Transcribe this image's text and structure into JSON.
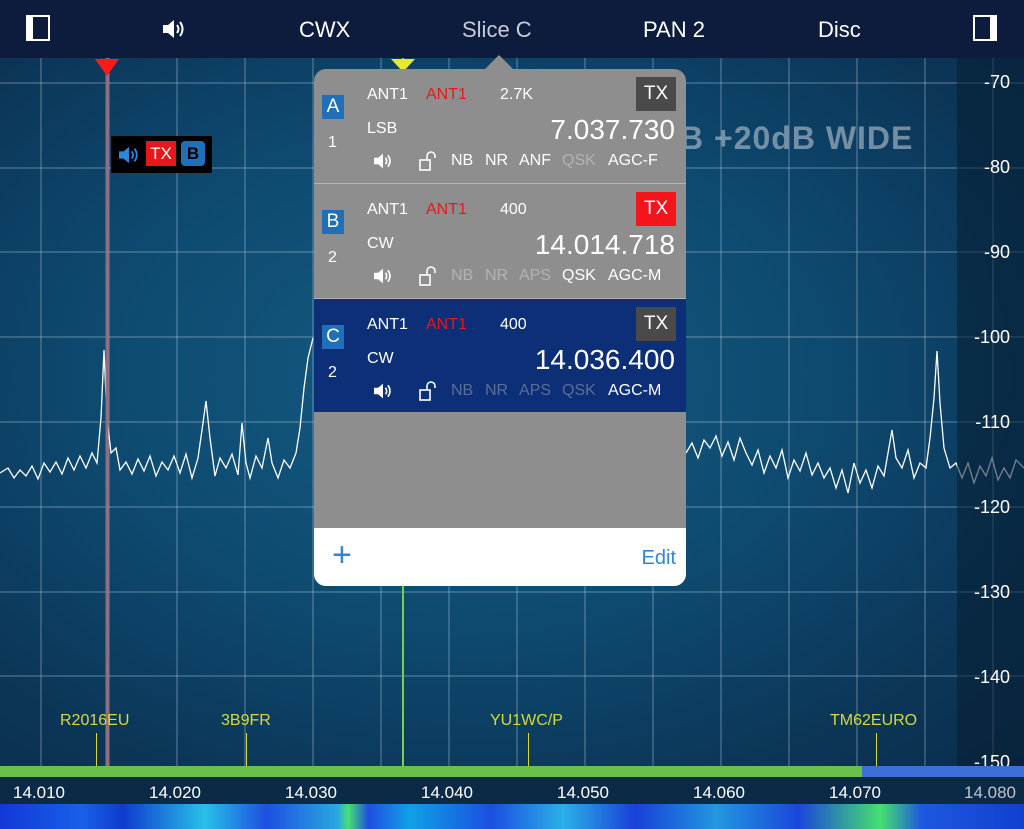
{
  "topbar": {
    "left_toggle": "sidebar-left-icon",
    "speaker": "speaker-icon",
    "mode": "CWX",
    "slice": "Slice C",
    "pan": "PAN 2",
    "disc": "Disc",
    "right_toggle": "sidebar-right-icon"
  },
  "panadapter": {
    "db_labels": [
      "-70",
      "-80",
      "-90",
      "-100",
      "-110",
      "-120",
      "-130",
      "-140",
      "-150"
    ],
    "overlay": "B  +20dB  WIDE",
    "freq_labels": [
      "14.010",
      "14.020",
      "14.030",
      "14.040",
      "14.050",
      "14.060",
      "14.070",
      "14.080"
    ],
    "spots": [
      "R2016EU",
      "3B9FR",
      "YU1WC/P",
      "TM62EURO"
    ],
    "badge": {
      "tx": "TX",
      "slice": "B"
    }
  },
  "slices": [
    {
      "letter": "A",
      "num": "1",
      "ant_rx": "ANT1",
      "ant_tx": "ANT1",
      "filter": "2.7K",
      "tx": "TX",
      "tx_active": false,
      "mode": "LSB",
      "freq": "7.037.730",
      "flags": [
        {
          "label": "NB",
          "on": true
        },
        {
          "label": "NR",
          "on": true
        },
        {
          "label": "ANF",
          "on": true
        },
        {
          "label": "QSK",
          "on": false
        },
        {
          "label": "AGC-F",
          "on": true
        }
      ]
    },
    {
      "letter": "B",
      "num": "2",
      "ant_rx": "ANT1",
      "ant_tx": "ANT1",
      "filter": "400",
      "tx": "TX",
      "tx_active": true,
      "mode": "CW",
      "freq": "14.014.718",
      "flags": [
        {
          "label": "NB",
          "on": false
        },
        {
          "label": "NR",
          "on": false
        },
        {
          "label": "APS",
          "on": false
        },
        {
          "label": "QSK",
          "on": true
        },
        {
          "label": "AGC-M",
          "on": true
        }
      ]
    },
    {
      "letter": "C",
      "num": "2",
      "ant_rx": "ANT1",
      "ant_tx": "ANT1",
      "filter": "400",
      "tx": "TX",
      "tx_active": false,
      "mode": "CW",
      "freq": "14.036.400",
      "flags": [
        {
          "label": "NB",
          "on": false
        },
        {
          "label": "NR",
          "on": false
        },
        {
          "label": "APS",
          "on": false
        },
        {
          "label": "QSK",
          "on": false
        },
        {
          "label": "AGC-M",
          "on": true
        }
      ]
    }
  ],
  "popover_footer": {
    "add": "+",
    "edit": "Edit"
  },
  "colors": {
    "tx_red": "#f5141a",
    "accent_blue": "#2f86d8",
    "active_slice": "#0c2f78",
    "spot_yellow": "#d8d83a"
  }
}
